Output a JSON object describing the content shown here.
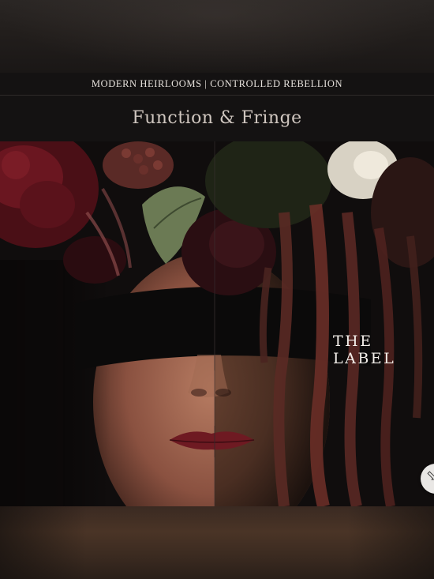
{
  "header": {
    "tagline": "MODERN HEIRLOOMS | CONTROLLED REBELLION",
    "collection_title": "Function & Fringe"
  },
  "hero": {
    "overlay_text": "THE LABEL",
    "next_icon": "arrow-right-icon"
  },
  "colors": {
    "background": "#141212",
    "tagline_text": "#e6e1dc",
    "title_text": "#cfc6bf",
    "overlay_text": "#f2eee9",
    "lip_color": "#6e1a22"
  }
}
